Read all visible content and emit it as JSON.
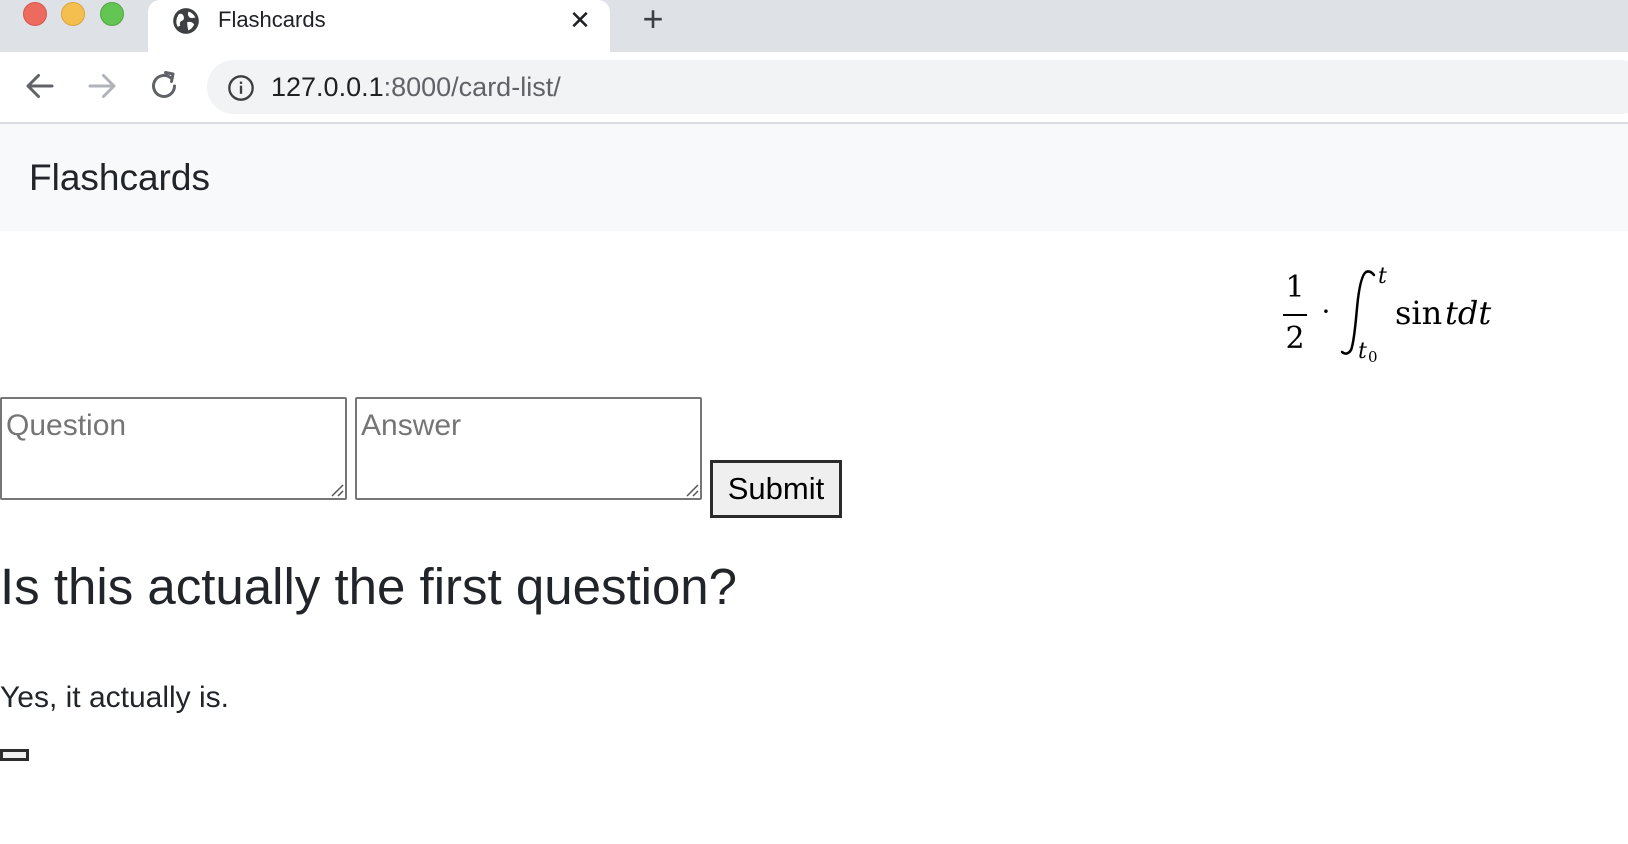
{
  "browser": {
    "tab_title": "Flashcards",
    "close_glyph": "✕",
    "newtab_glyph": "+",
    "url_host": "127.0.0.1",
    "url_path": ":8000/card-list/"
  },
  "page": {
    "brand": "Flashcards",
    "formula": {
      "fraction_numerator": "1",
      "fraction_denominator": "2",
      "operator": "·",
      "integral_upper": "t",
      "integral_lower_base": "t",
      "integral_lower_sub": "0",
      "integrand_func": "sin",
      "integrand_body": "tdt"
    },
    "form": {
      "question_placeholder": "Question",
      "answer_placeholder": "Answer",
      "submit_label": "Submit"
    },
    "card": {
      "question": "Is this actually the first question?",
      "answer": "Yes, it actually is."
    }
  },
  "colors": {
    "tabstrip": "#dee1e6",
    "navbar": "#f8f9fa",
    "text": "#212529",
    "traffic_red": "#ed6a5e",
    "traffic_yellow": "#f5bf4f",
    "traffic_green": "#62c554"
  }
}
